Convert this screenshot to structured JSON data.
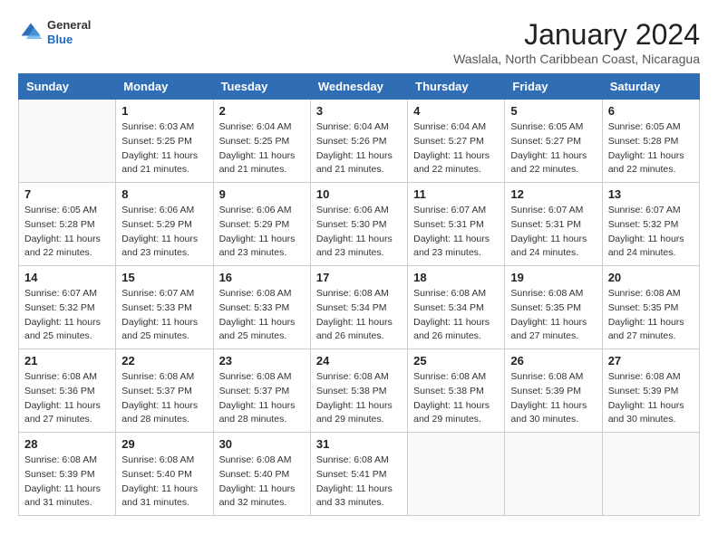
{
  "logo": {
    "general": "General",
    "blue": "Blue"
  },
  "title": "January 2024",
  "location": "Waslala, North Caribbean Coast, Nicaragua",
  "headers": [
    "Sunday",
    "Monday",
    "Tuesday",
    "Wednesday",
    "Thursday",
    "Friday",
    "Saturday"
  ],
  "weeks": [
    [
      {
        "day": "",
        "sunrise": "",
        "sunset": "",
        "daylight": ""
      },
      {
        "day": "1",
        "sunrise": "Sunrise: 6:03 AM",
        "sunset": "Sunset: 5:25 PM",
        "daylight": "Daylight: 11 hours and 21 minutes."
      },
      {
        "day": "2",
        "sunrise": "Sunrise: 6:04 AM",
        "sunset": "Sunset: 5:25 PM",
        "daylight": "Daylight: 11 hours and 21 minutes."
      },
      {
        "day": "3",
        "sunrise": "Sunrise: 6:04 AM",
        "sunset": "Sunset: 5:26 PM",
        "daylight": "Daylight: 11 hours and 21 minutes."
      },
      {
        "day": "4",
        "sunrise": "Sunrise: 6:04 AM",
        "sunset": "Sunset: 5:27 PM",
        "daylight": "Daylight: 11 hours and 22 minutes."
      },
      {
        "day": "5",
        "sunrise": "Sunrise: 6:05 AM",
        "sunset": "Sunset: 5:27 PM",
        "daylight": "Daylight: 11 hours and 22 minutes."
      },
      {
        "day": "6",
        "sunrise": "Sunrise: 6:05 AM",
        "sunset": "Sunset: 5:28 PM",
        "daylight": "Daylight: 11 hours and 22 minutes."
      }
    ],
    [
      {
        "day": "7",
        "sunrise": "Sunrise: 6:05 AM",
        "sunset": "Sunset: 5:28 PM",
        "daylight": "Daylight: 11 hours and 22 minutes."
      },
      {
        "day": "8",
        "sunrise": "Sunrise: 6:06 AM",
        "sunset": "Sunset: 5:29 PM",
        "daylight": "Daylight: 11 hours and 23 minutes."
      },
      {
        "day": "9",
        "sunrise": "Sunrise: 6:06 AM",
        "sunset": "Sunset: 5:29 PM",
        "daylight": "Daylight: 11 hours and 23 minutes."
      },
      {
        "day": "10",
        "sunrise": "Sunrise: 6:06 AM",
        "sunset": "Sunset: 5:30 PM",
        "daylight": "Daylight: 11 hours and 23 minutes."
      },
      {
        "day": "11",
        "sunrise": "Sunrise: 6:07 AM",
        "sunset": "Sunset: 5:31 PM",
        "daylight": "Daylight: 11 hours and 23 minutes."
      },
      {
        "day": "12",
        "sunrise": "Sunrise: 6:07 AM",
        "sunset": "Sunset: 5:31 PM",
        "daylight": "Daylight: 11 hours and 24 minutes."
      },
      {
        "day": "13",
        "sunrise": "Sunrise: 6:07 AM",
        "sunset": "Sunset: 5:32 PM",
        "daylight": "Daylight: 11 hours and 24 minutes."
      }
    ],
    [
      {
        "day": "14",
        "sunrise": "Sunrise: 6:07 AM",
        "sunset": "Sunset: 5:32 PM",
        "daylight": "Daylight: 11 hours and 25 minutes."
      },
      {
        "day": "15",
        "sunrise": "Sunrise: 6:07 AM",
        "sunset": "Sunset: 5:33 PM",
        "daylight": "Daylight: 11 hours and 25 minutes."
      },
      {
        "day": "16",
        "sunrise": "Sunrise: 6:08 AM",
        "sunset": "Sunset: 5:33 PM",
        "daylight": "Daylight: 11 hours and 25 minutes."
      },
      {
        "day": "17",
        "sunrise": "Sunrise: 6:08 AM",
        "sunset": "Sunset: 5:34 PM",
        "daylight": "Daylight: 11 hours and 26 minutes."
      },
      {
        "day": "18",
        "sunrise": "Sunrise: 6:08 AM",
        "sunset": "Sunset: 5:34 PM",
        "daylight": "Daylight: 11 hours and 26 minutes."
      },
      {
        "day": "19",
        "sunrise": "Sunrise: 6:08 AM",
        "sunset": "Sunset: 5:35 PM",
        "daylight": "Daylight: 11 hours and 27 minutes."
      },
      {
        "day": "20",
        "sunrise": "Sunrise: 6:08 AM",
        "sunset": "Sunset: 5:35 PM",
        "daylight": "Daylight: 11 hours and 27 minutes."
      }
    ],
    [
      {
        "day": "21",
        "sunrise": "Sunrise: 6:08 AM",
        "sunset": "Sunset: 5:36 PM",
        "daylight": "Daylight: 11 hours and 27 minutes."
      },
      {
        "day": "22",
        "sunrise": "Sunrise: 6:08 AM",
        "sunset": "Sunset: 5:37 PM",
        "daylight": "Daylight: 11 hours and 28 minutes."
      },
      {
        "day": "23",
        "sunrise": "Sunrise: 6:08 AM",
        "sunset": "Sunset: 5:37 PM",
        "daylight": "Daylight: 11 hours and 28 minutes."
      },
      {
        "day": "24",
        "sunrise": "Sunrise: 6:08 AM",
        "sunset": "Sunset: 5:38 PM",
        "daylight": "Daylight: 11 hours and 29 minutes."
      },
      {
        "day": "25",
        "sunrise": "Sunrise: 6:08 AM",
        "sunset": "Sunset: 5:38 PM",
        "daylight": "Daylight: 11 hours and 29 minutes."
      },
      {
        "day": "26",
        "sunrise": "Sunrise: 6:08 AM",
        "sunset": "Sunset: 5:39 PM",
        "daylight": "Daylight: 11 hours and 30 minutes."
      },
      {
        "day": "27",
        "sunrise": "Sunrise: 6:08 AM",
        "sunset": "Sunset: 5:39 PM",
        "daylight": "Daylight: 11 hours and 30 minutes."
      }
    ],
    [
      {
        "day": "28",
        "sunrise": "Sunrise: 6:08 AM",
        "sunset": "Sunset: 5:39 PM",
        "daylight": "Daylight: 11 hours and 31 minutes."
      },
      {
        "day": "29",
        "sunrise": "Sunrise: 6:08 AM",
        "sunset": "Sunset: 5:40 PM",
        "daylight": "Daylight: 11 hours and 31 minutes."
      },
      {
        "day": "30",
        "sunrise": "Sunrise: 6:08 AM",
        "sunset": "Sunset: 5:40 PM",
        "daylight": "Daylight: 11 hours and 32 minutes."
      },
      {
        "day": "31",
        "sunrise": "Sunrise: 6:08 AM",
        "sunset": "Sunset: 5:41 PM",
        "daylight": "Daylight: 11 hours and 33 minutes."
      },
      {
        "day": "",
        "sunrise": "",
        "sunset": "",
        "daylight": ""
      },
      {
        "day": "",
        "sunrise": "",
        "sunset": "",
        "daylight": ""
      },
      {
        "day": "",
        "sunrise": "",
        "sunset": "",
        "daylight": ""
      }
    ]
  ]
}
